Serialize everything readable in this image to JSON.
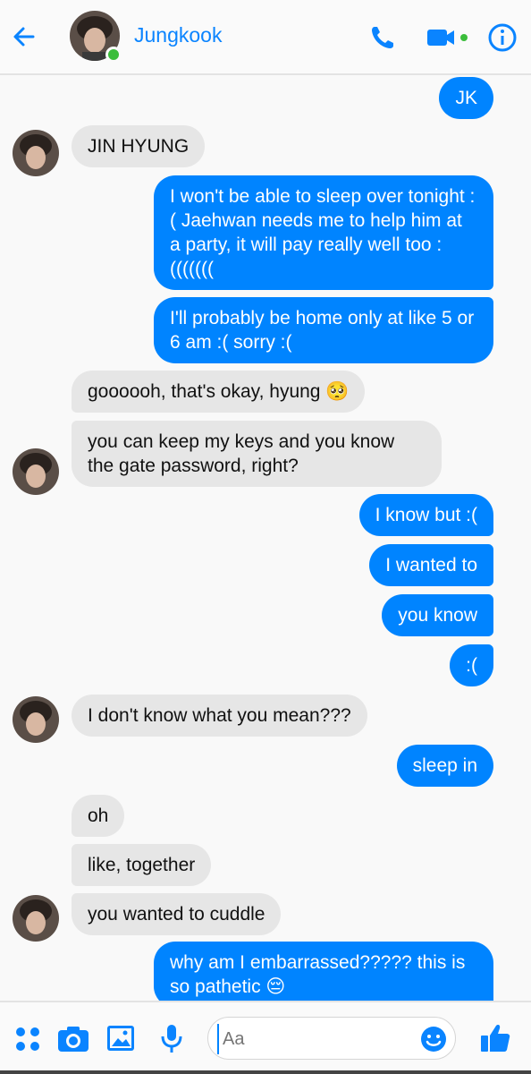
{
  "header": {
    "contact_name": "Jungkook",
    "status": "online"
  },
  "messages": [
    {
      "side": "out",
      "text": "JK"
    },
    {
      "side": "in",
      "text": "JIN HYUNG"
    },
    {
      "side": "out",
      "text": "I won't be able to sleep over tonight :( Jaehwan needs me to help him at a party, it will pay really well too :((((((("
    },
    {
      "side": "out",
      "text": "I'll probably be home only at like 5 or 6 am :( sorry :("
    },
    {
      "side": "in",
      "text": "goooooh, that's okay, hyung 🥺"
    },
    {
      "side": "in",
      "text": "you can keep my keys and you know the gate password, right?"
    },
    {
      "side": "out",
      "text": "I know but :("
    },
    {
      "side": "out",
      "text": "I wanted to"
    },
    {
      "side": "out",
      "text": "you know"
    },
    {
      "side": "out",
      "text": ":("
    },
    {
      "side": "in",
      "text": "I don't know what you mean???"
    },
    {
      "side": "out",
      "text": "sleep in"
    },
    {
      "side": "in",
      "text": "oh"
    },
    {
      "side": "in",
      "text": "like, together"
    },
    {
      "side": "in",
      "text": "you wanted to cuddle"
    },
    {
      "side": "out",
      "text": "why am I embarrassed????? this is so pathetic 😔"
    }
  ],
  "composer": {
    "placeholder": "Aa"
  },
  "colors": {
    "accent": "#0084ff",
    "incoming_bubble": "#e6e6e6",
    "online": "#3bbd3b"
  }
}
